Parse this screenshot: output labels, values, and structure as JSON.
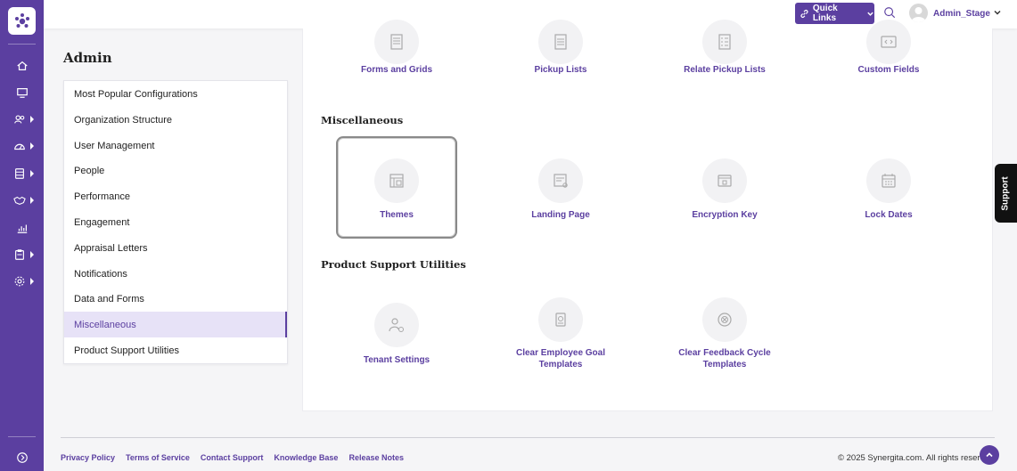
{
  "colors": {
    "brand": "#5b3fa0",
    "active_bg": "#e7e2f7"
  },
  "topbar": {
    "quick_links_label": "Quick Links",
    "user_name": "Admin_Stage"
  },
  "admin": {
    "title": "Admin"
  },
  "menu": {
    "items": [
      {
        "label": "Most Popular Configurations",
        "active": false
      },
      {
        "label": "Organization Structure",
        "active": false
      },
      {
        "label": "User Management",
        "active": false
      },
      {
        "label": "People",
        "active": false
      },
      {
        "label": "Performance",
        "active": false
      },
      {
        "label": "Engagement",
        "active": false
      },
      {
        "label": "Appraisal Letters",
        "active": false
      },
      {
        "label": "Notifications",
        "active": false
      },
      {
        "label": "Data and Forms",
        "active": false
      },
      {
        "label": "Miscellaneous",
        "active": true
      },
      {
        "label": "Product Support Utilities",
        "active": false
      }
    ]
  },
  "data_forms_row": {
    "tiles": [
      {
        "label": "Forms and Grids",
        "icon": "form-icon"
      },
      {
        "label": "Pickup Lists",
        "icon": "list-icon"
      },
      {
        "label": "Relate Pickup Lists",
        "icon": "relate-list-icon"
      },
      {
        "label": "Custom Fields",
        "icon": "code-icon"
      }
    ]
  },
  "miscellaneous": {
    "title": "Miscellaneous",
    "tiles": [
      {
        "label": "Themes",
        "icon": "theme-icon",
        "selected": true
      },
      {
        "label": "Landing Page",
        "icon": "landing-page-icon"
      },
      {
        "label": "Encryption Key",
        "icon": "lock-icon"
      },
      {
        "label": "Lock Dates",
        "icon": "calendar-icon"
      }
    ]
  },
  "product_support": {
    "title": "Product Support Utilities",
    "tiles": [
      {
        "label": "Tenant Settings",
        "icon": "tenant-settings-icon"
      },
      {
        "label": "Clear Employee Goal Templates",
        "icon": "clear-goal-icon"
      },
      {
        "label": "Clear Feedback Cycle Templates",
        "icon": "clear-feedback-icon"
      }
    ]
  },
  "support_tab": {
    "label": "Support"
  },
  "footer": {
    "links": [
      "Privacy Policy",
      "Terms of Service",
      "Contact Support",
      "Knowledge Base",
      "Release Notes"
    ],
    "copyright": "© 2025 Synergita.com. All rights reserved."
  }
}
